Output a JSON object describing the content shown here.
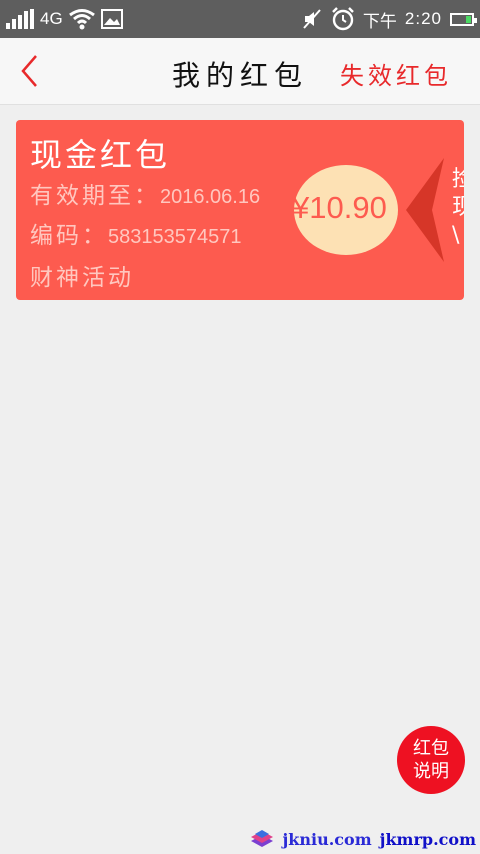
{
  "status_bar": {
    "network": "4G",
    "time_period": "下午",
    "time": "2:20",
    "icons": [
      "signal-icon",
      "wifi-icon",
      "image-notification-icon",
      "mute-icon",
      "alarm-icon",
      "battery-icon"
    ]
  },
  "header": {
    "title": "我的红包",
    "expired_link": "失效红包",
    "back_icon": "back-arrow-icon"
  },
  "card": {
    "type": "现金红包",
    "expiry_label": "有效期至：",
    "expiry_value": "2016.06.16",
    "code_label": "编码：",
    "code_value": "583153574571",
    "source": "财神活动",
    "amount": "¥10.90",
    "side_text": [
      "捡",
      "现",
      "\\"
    ],
    "colors": {
      "card": "#fd5b4f",
      "amount_circle": "#fde1b4",
      "chevron": "#d63628"
    }
  },
  "fab": {
    "line1": "红包",
    "line2": "说明"
  },
  "watermark": {
    "site1": "jkniu.com",
    "site2": "jkmrp.com"
  },
  "colors": {
    "status_bar": "#5e5e5e",
    "header_bg": "#f7f7f7",
    "page_bg": "#efefef",
    "accent_red": "#e8292b"
  }
}
